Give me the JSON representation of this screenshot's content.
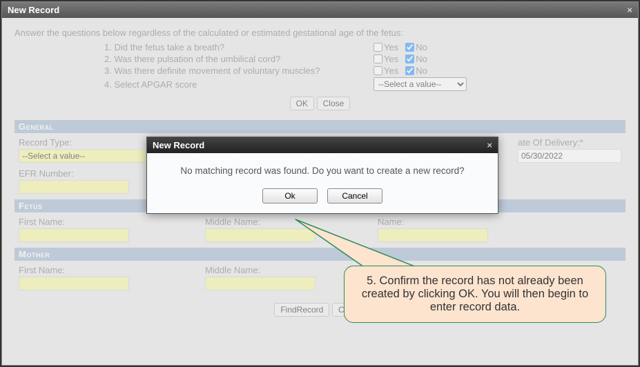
{
  "outer": {
    "title": "New Record",
    "close_x": "×",
    "instruction": "Answer the questions below regardless of the calculated or estimated gestational age of the fetus:",
    "questions": [
      {
        "text": "1. Did the fetus take a breath?",
        "yes_label": "Yes",
        "no_label": "No",
        "yes_checked": false,
        "no_checked": true
      },
      {
        "text": "2. Was there pulsation of the umbilical cord?",
        "yes_label": "Yes",
        "no_label": "No",
        "yes_checked": false,
        "no_checked": true
      },
      {
        "text": "3. Was there definite movement of voluntary muscles?",
        "yes_label": "Yes",
        "no_label": "No",
        "yes_checked": false,
        "no_checked": true
      }
    ],
    "apgar": {
      "label": "4. Select APGAR score",
      "placeholder": "--Select a value--"
    },
    "ok_label": "OK",
    "close_label": "Close",
    "sections": {
      "general": {
        "title": "General",
        "record_type_label": "Record Type:",
        "record_type_value": "--Select a value--",
        "date_of_delivery_label": "ate Of Delivery:*",
        "date_of_delivery_value": "05/30/2022",
        "efr_label": "EFR Number:",
        "efr_value": ""
      },
      "fetus": {
        "title": "Fetus",
        "first_name_label": "First Name:",
        "first_name_value": "",
        "middle_name_label": "Middle Name:",
        "middle_name_value": "",
        "last_name_label": "Name:",
        "last_name_value": ""
      },
      "mother": {
        "title": "Mother",
        "first_name_label": "First Name:",
        "first_name_value": "",
        "middle_name_label": "Middle Name:",
        "middle_name_value": ""
      }
    },
    "findrecord_label": "FindRecord",
    "close2_label": "Close"
  },
  "modal": {
    "title": "New Record",
    "close_x": "×",
    "message": "No matching record was found. Do you want to create a new record?",
    "ok_label": "Ok",
    "cancel_label": "Cancel"
  },
  "callout": {
    "text": "5. Confirm the record has not already been created by clicking OK. You will then begin to enter record data."
  }
}
